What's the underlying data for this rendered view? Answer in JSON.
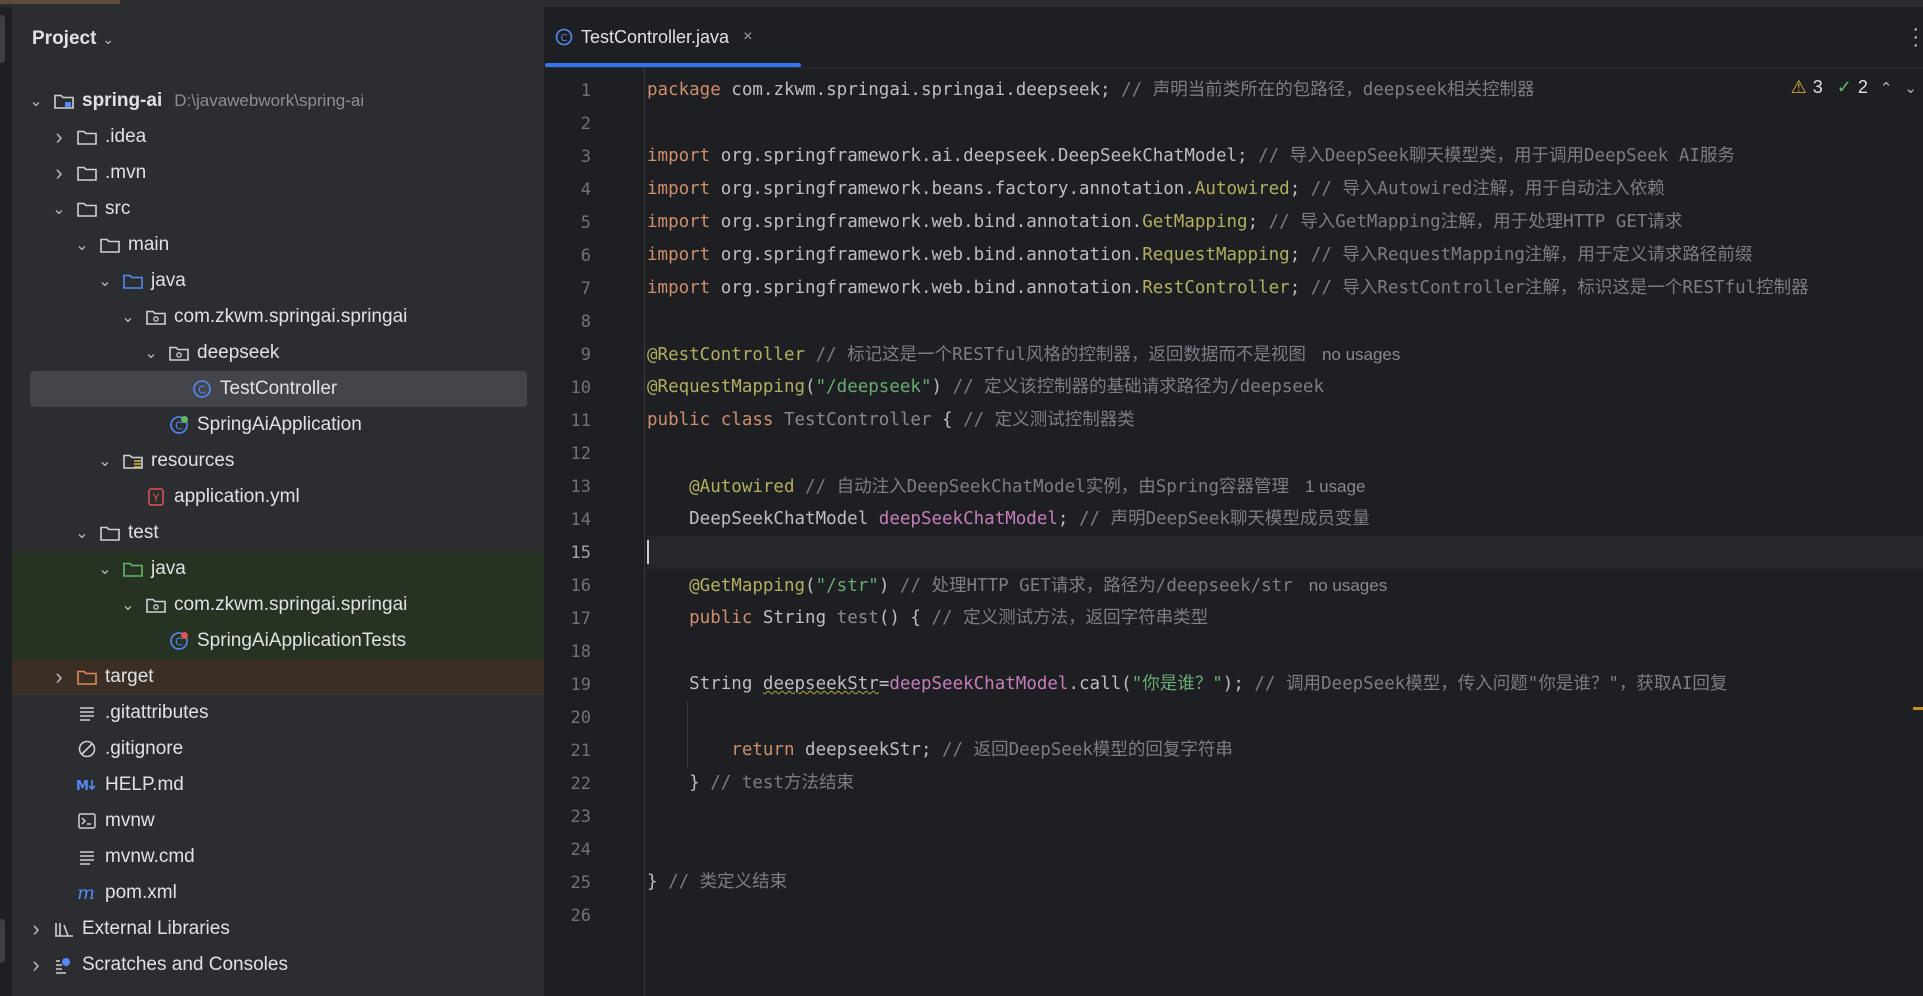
{
  "project": {
    "title": "Project",
    "tree": [
      {
        "label": "spring-ai",
        "hint": "D:\\javawebwork\\spring-ai",
        "icon": "module-folder-icon",
        "depth": 1,
        "expanded": true,
        "bold": true
      },
      {
        "label": ".idea",
        "icon": "folder-icon",
        "depth": 2,
        "expanded": false
      },
      {
        "label": ".mvn",
        "icon": "folder-icon",
        "depth": 2,
        "expanded": false
      },
      {
        "label": "src",
        "icon": "folder-icon",
        "depth": 2,
        "expanded": true
      },
      {
        "label": "main",
        "icon": "folder-icon",
        "depth": 3,
        "expanded": true
      },
      {
        "label": "java",
        "icon": "source-folder-icon",
        "depth": 4,
        "expanded": true
      },
      {
        "label": "com.zkwm.springai.springai",
        "icon": "package-icon",
        "depth": 5,
        "expanded": true
      },
      {
        "label": "deepseek",
        "icon": "package-icon",
        "depth": 6,
        "expanded": true
      },
      {
        "label": "TestController",
        "icon": "class-icon",
        "depth": 7,
        "selected": true
      },
      {
        "label": "SpringAiApplication",
        "icon": "spring-boot-class-icon",
        "depth": 6
      },
      {
        "label": "resources",
        "icon": "resources-folder-icon",
        "depth": 4,
        "expanded": true
      },
      {
        "label": "application.yml",
        "icon": "yaml-file-icon",
        "depth": 5
      },
      {
        "label": "test",
        "icon": "folder-icon",
        "depth": 3,
        "expanded": true
      },
      {
        "label": "java",
        "icon": "test-source-folder-icon",
        "depth": 4,
        "expanded": true,
        "test": true
      },
      {
        "label": "com.zkwm.springai.springai",
        "icon": "package-icon",
        "depth": 5,
        "expanded": true,
        "test": true
      },
      {
        "label": "SpringAiApplicationTests",
        "icon": "spring-boot-test-class-icon",
        "depth": 6,
        "test": true
      },
      {
        "label": "target",
        "icon": "excluded-folder-icon",
        "depth": 2,
        "expanded": false,
        "target": true
      },
      {
        "label": ".gitattributes",
        "icon": "text-file-icon",
        "depth": 2
      },
      {
        "label": ".gitignore",
        "icon": "gitignore-icon",
        "depth": 2
      },
      {
        "label": "HELP.md",
        "icon": "markdown-icon",
        "depth": 2
      },
      {
        "label": "mvnw",
        "icon": "terminal-file-icon",
        "depth": 2
      },
      {
        "label": "mvnw.cmd",
        "icon": "text-file-icon",
        "depth": 2
      },
      {
        "label": "pom.xml",
        "icon": "maven-icon",
        "depth": 2
      },
      {
        "label": "External Libraries",
        "icon": "libraries-icon",
        "depth": 1,
        "expanded": false
      },
      {
        "label": "Scratches and Consoles",
        "icon": "scratches-icon",
        "depth": 1,
        "expanded": false
      }
    ]
  },
  "editor": {
    "tab_label": "TestController.java",
    "tab_close": "×",
    "warnings_count": "3",
    "ok_count": "2",
    "current_line": 15,
    "line_numbers": [
      "1",
      "2",
      "3",
      "4",
      "5",
      "6",
      "7",
      "8",
      "9",
      "10",
      "11",
      "12",
      "13",
      "14",
      "15",
      "16",
      "17",
      "18",
      "19",
      "20",
      "21",
      "22",
      "23",
      "24",
      "25",
      "26"
    ],
    "lines": [
      [
        {
          "t": "package ",
          "c": "kw"
        },
        {
          "t": "com.zkwm.springai.springai.deepseek; ",
          "c": "cls"
        },
        {
          "t": "// 声明当前类所在的包路径，deepseek相关控制器",
          "c": "cm"
        }
      ],
      [],
      [
        {
          "t": "import ",
          "c": "kw"
        },
        {
          "t": "org.springframework.ai.deepseek.DeepSeekChatModel; ",
          "c": "cls"
        },
        {
          "t": "// 导入DeepSeek聊天模型类，用于调用DeepSeek AI服务",
          "c": "cm"
        }
      ],
      [
        {
          "t": "import ",
          "c": "kw"
        },
        {
          "t": "org.springframework.beans.factory.annotation.",
          "c": "cls"
        },
        {
          "t": "Autowired",
          "c": "ann"
        },
        {
          "t": "; ",
          "c": "cls"
        },
        {
          "t": "// 导入Autowired注解，用于自动注入依赖",
          "c": "cm"
        }
      ],
      [
        {
          "t": "import ",
          "c": "kw"
        },
        {
          "t": "org.springframework.web.bind.annotation.",
          "c": "cls"
        },
        {
          "t": "GetMapping",
          "c": "ann"
        },
        {
          "t": "; ",
          "c": "cls"
        },
        {
          "t": "// 导入GetMapping注解，用于处理HTTP GET请求",
          "c": "cm"
        }
      ],
      [
        {
          "t": "import ",
          "c": "kw"
        },
        {
          "t": "org.springframework.web.bind.annotation.",
          "c": "cls"
        },
        {
          "t": "RequestMapping",
          "c": "ann"
        },
        {
          "t": "; ",
          "c": "cls"
        },
        {
          "t": "// 导入RequestMapping注解，用于定义请求路径前缀",
          "c": "cm"
        }
      ],
      [
        {
          "t": "import ",
          "c": "kw"
        },
        {
          "t": "org.springframework.web.bind.annotation.",
          "c": "cls"
        },
        {
          "t": "RestController",
          "c": "ann"
        },
        {
          "t": "; ",
          "c": "cls"
        },
        {
          "t": "// 导入RestController注解，标识这是一个RESTful控制器",
          "c": "cm"
        }
      ],
      [],
      [
        {
          "t": "@RestController ",
          "c": "ann"
        },
        {
          "t": "// 标记这是一个RESTful风格的控制器，返回数据而不是视图",
          "c": "cm"
        },
        {
          "t": "no usages",
          "c": "hint"
        }
      ],
      [
        {
          "t": "@RequestMapping",
          "c": "ann"
        },
        {
          "t": "(",
          "c": "cls"
        },
        {
          "t": "\"/deepseek\"",
          "c": "str"
        },
        {
          "t": ") ",
          "c": "cls"
        },
        {
          "t": "// 定义该控制器的基础请求路径为/deepseek",
          "c": "cm"
        }
      ],
      [
        {
          "t": "public class ",
          "c": "kw"
        },
        {
          "t": "TestController ",
          "c": "unused"
        },
        {
          "t": "{ ",
          "c": "cls"
        },
        {
          "t": "// 定义测试控制器类",
          "c": "cm"
        }
      ],
      [],
      [
        {
          "t": "    @Autowired ",
          "c": "ann"
        },
        {
          "t": "// 自动注入DeepSeekChatModel实例，由Spring容器管理",
          "c": "cm"
        },
        {
          "t": "1 usage",
          "c": "hint"
        }
      ],
      [
        {
          "t": "    DeepSeekChatModel ",
          "c": "cls"
        },
        {
          "t": "deepSeekChatModel",
          "c": "fld"
        },
        {
          "t": "; ",
          "c": "cls"
        },
        {
          "t": "// 声明DeepSeek聊天模型成员变量",
          "c": "cm"
        }
      ],
      [],
      [
        {
          "t": "    @GetMapping",
          "c": "ann"
        },
        {
          "t": "(",
          "c": "cls"
        },
        {
          "t": "\"/str\"",
          "c": "str"
        },
        {
          "t": ") ",
          "c": "cls"
        },
        {
          "t": "// 处理HTTP GET请求，路径为/deepseek/str",
          "c": "cm"
        },
        {
          "t": "no usages",
          "c": "hint"
        }
      ],
      [
        {
          "t": "    public ",
          "c": "kw"
        },
        {
          "t": "String ",
          "c": "cls"
        },
        {
          "t": "test",
          "c": "unused"
        },
        {
          "t": "() { ",
          "c": "cls"
        },
        {
          "t": "// 定义测试方法，返回字符串类型",
          "c": "cm"
        }
      ],
      [],
      [
        {
          "t": "    String ",
          "c": "cls"
        },
        {
          "t": "deepseekStr",
          "c": "cls warn-ul"
        },
        {
          "t": "=",
          "c": "cls"
        },
        {
          "t": "deepSeekChatModel",
          "c": "fld"
        },
        {
          "t": ".call(",
          "c": "cls"
        },
        {
          "t": "\"你是谁？\"",
          "c": "str"
        },
        {
          "t": "); ",
          "c": "cls"
        },
        {
          "t": "// 调用DeepSeek模型，传入问题\"你是谁？\"，获取AI回复",
          "c": "cm"
        }
      ],
      [],
      [
        {
          "t": "        return ",
          "c": "kw"
        },
        {
          "t": "deepseekStr; ",
          "c": "cls"
        },
        {
          "t": "// 返回DeepSeek模型的回复字符串",
          "c": "cm"
        }
      ],
      [
        {
          "t": "    } ",
          "c": "cls"
        },
        {
          "t": "// test方法结束",
          "c": "cm"
        }
      ],
      [],
      [],
      [
        {
          "t": "} ",
          "c": "cls"
        },
        {
          "t": "// 类定义结束",
          "c": "cm"
        }
      ],
      []
    ]
  },
  "colors": {
    "accent": "#3574f0",
    "keyword": "#cf8e6d",
    "annotation": "#b3ae60",
    "string": "#6aab73",
    "field": "#c77dbb",
    "comment": "#7a7e85"
  }
}
